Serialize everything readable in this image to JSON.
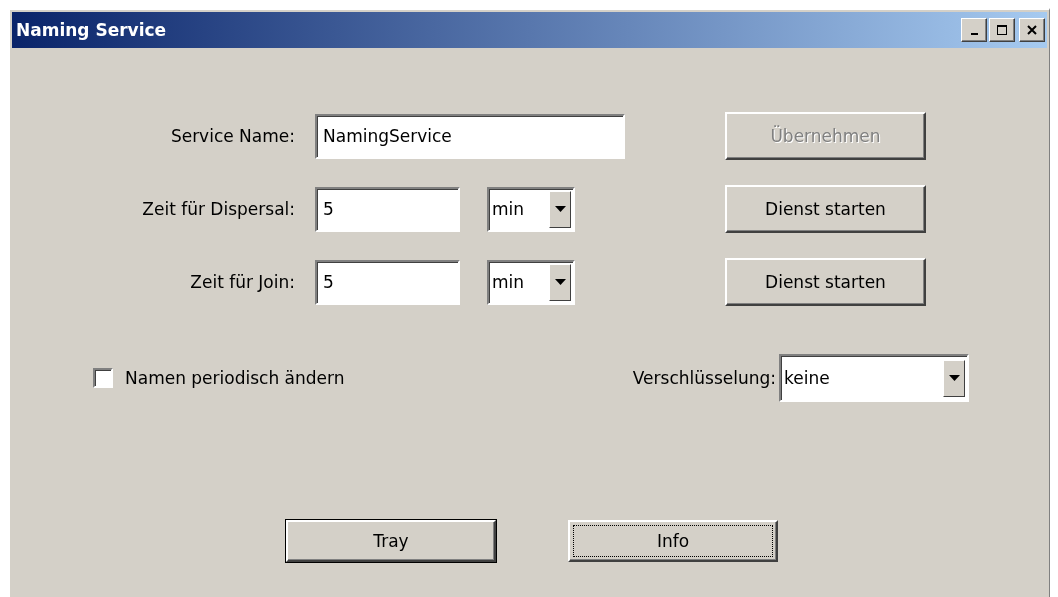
{
  "window": {
    "title": "Naming Service"
  },
  "service_name": {
    "label": "Service Name:",
    "value": "NamingService"
  },
  "apply_button": {
    "label": "Übernehmen",
    "disabled": true
  },
  "timers": [
    {
      "label": "Zeit für Dispersal:",
      "value": "5",
      "unit": "min",
      "button": {
        "label": "Dienst starten",
        "disabled": false
      }
    },
    {
      "label": "Zeit für Join:",
      "value": "5",
      "unit": "min",
      "button": {
        "label": "Dienst starten",
        "disabled": false
      }
    }
  ],
  "rename_option": {
    "label": "Namen periodisch ändern",
    "checked": false
  },
  "encryption": {
    "label": "Verschlüsselung:",
    "value": "keine"
  },
  "buttons": [
    {
      "label": "Tray",
      "default": true,
      "focused": false
    },
    {
      "label": "Info",
      "default": false,
      "focused": true
    }
  ]
}
